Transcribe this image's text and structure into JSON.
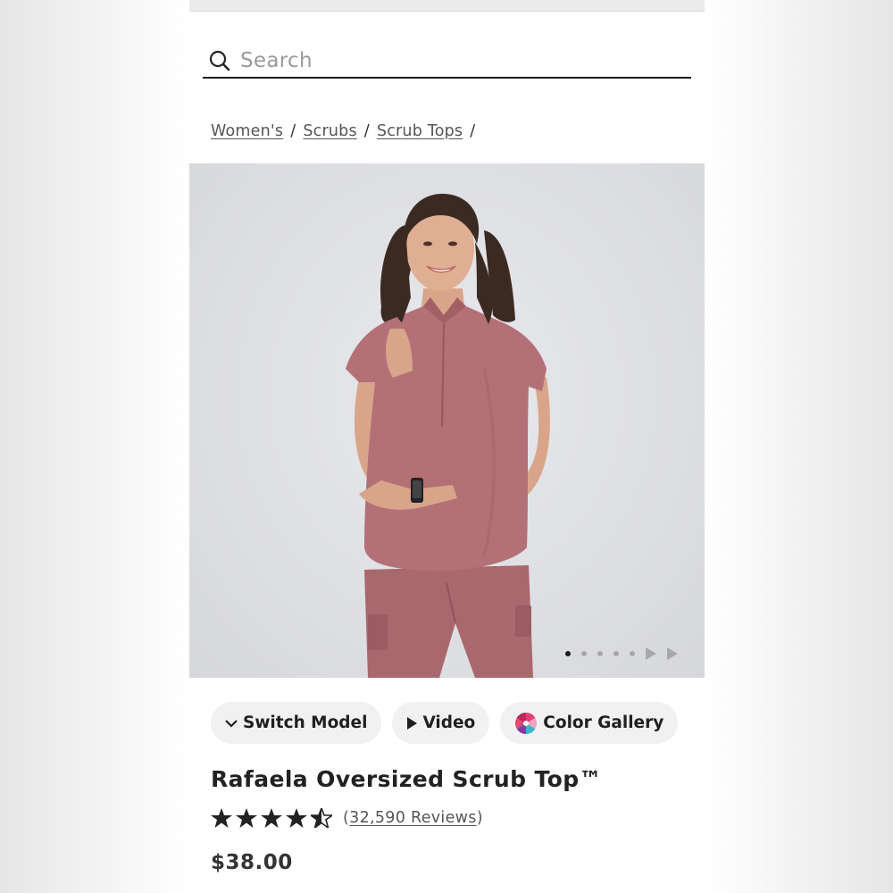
{
  "search": {
    "placeholder": "Search",
    "icon": "search-icon"
  },
  "breadcrumb": {
    "items": [
      "Women's",
      "Scrubs",
      "Scrub Tops"
    ],
    "separator": "/"
  },
  "gallery": {
    "image": "Model wearing pink scrub top and pants",
    "slide_count": 5,
    "active_slide": 1
  },
  "actions": {
    "switch_model": "Switch Model",
    "video": "Video",
    "color_gallery": "Color Gallery"
  },
  "product": {
    "title": "Rafaela Oversized Scrub Top™",
    "rating": 4.5,
    "reviews_open": "(",
    "reviews_text": "32,590 Reviews",
    "reviews_close": ")",
    "price": "$38.00"
  },
  "colors": {
    "scrub": "#b47077",
    "text": "#222222",
    "chip_bg": "#f1f1f1"
  }
}
